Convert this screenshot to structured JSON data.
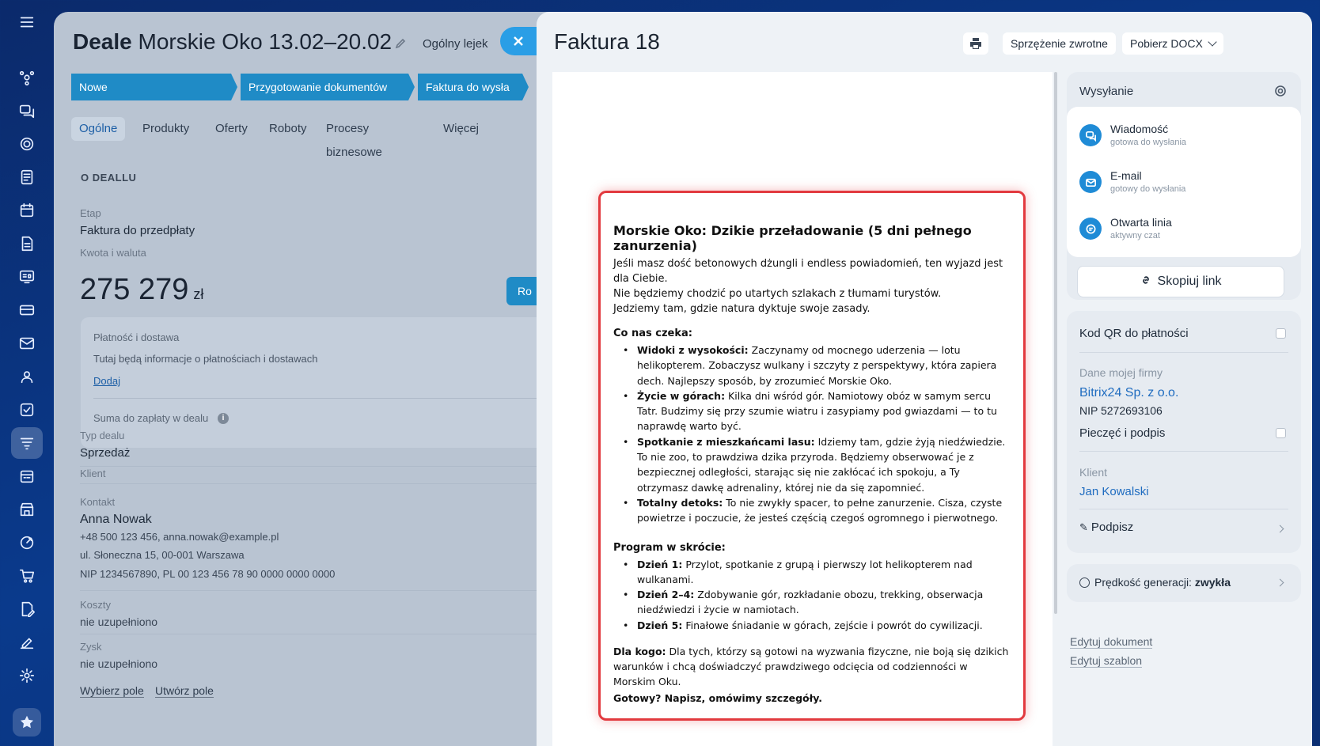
{
  "deal": {
    "title_bold": "Deale",
    "title_rest": " Morskie Oko 13.02–20.02",
    "funnel": "Ogólny lejek",
    "stages": [
      "Nowe",
      "Przygotowanie dokumentów",
      "Faktura do wysła"
    ],
    "tabs": [
      "Ogólne",
      "Produkty",
      "Oferty",
      "Roboty",
      "Procesy biznesowe",
      "Więcej"
    ],
    "section": "O DEALLU",
    "stage_label": "Etap",
    "stage_value": "Faktura do przedpłaty",
    "amount_label": "Kwota i waluta",
    "amount": "275 279",
    "currency": "zł",
    "ro_button": "Ro",
    "payment": {
      "title": "Płatność i dostawa",
      "text": "Tutaj będą informacje o płatnościach i dostawach",
      "add": "Dodaj",
      "sum": "Suma do zapłaty w dealu"
    },
    "type_label": "Typ dealu",
    "type_value": "Sprzedaż",
    "client_label": "Klient",
    "contact_label": "Kontakt",
    "contact_name": "Anna Nowak",
    "contact_phone": "+48 500 123 456, anna.nowak@example.pl",
    "contact_addr": "ul. Słoneczna 15, 00-001 Warszawa",
    "contact_nip": "NIP 1234567890, PL 00 123 456 78 90 0000 0000 0000",
    "costs_label": "Koszty",
    "costs_value": "nie uzupełniono",
    "profit_label": "Zysk",
    "profit_value": "nie uzupełniono",
    "choose_field": "Wybierz pole",
    "create_field": "Utwórz pole"
  },
  "panel": {
    "title": "Faktura 18",
    "feedback": "Sprzężenie zwrotne",
    "download": "Pobierz DOCX"
  },
  "document": {
    "heading": "Morskie Oko: Dzikie przeładowanie (5 dni pełnego zanurzenia)",
    "intro": [
      "Jeśli masz dość betonowych dżungli i endless powiadomień, ten wyjazd jest dla Ciebie.",
      "Nie będziemy chodzić po utartych szlakach z tłumami turystów.",
      "Jedziemy tam, gdzie natura dyktuje swoje zasady."
    ],
    "offer_title": "Co nas czeka:",
    "offer": [
      {
        "b": "Widoki z wysokości:",
        "t": " Zaczynamy od mocnego uderzenia — lotu helikopterem. Zobaczysz wulkany i szczyty z perspektywy, która zapiera dech. Najlepszy sposób, by zrozumieć Morskie Oko."
      },
      {
        "b": "Życie w górach:",
        "t": " Kilka dni wśród gór. Namiotowy obóz w samym sercu Tatr. Budzimy się przy szumie wiatru i zasypiamy pod gwiazdami — to tu naprawdę warto być."
      },
      {
        "b": "Spotkanie z mieszkańcami lasu:",
        "t": " Idziemy tam, gdzie żyją niedźwiedzie. To nie zoo, to prawdziwa dzika przyroda. Będziemy obserwować je z bezpiecznej odległości, starając się nie zakłócać ich spokoju, a Ty otrzymasz dawkę adrenaliny, której nie da się zapomnieć."
      },
      {
        "b": "Totalny detoks:",
        "t": " To nie zwykły spacer, to pełne zanurzenie. Cisza, czyste powietrze i poczucie, że jesteś częścią czegoś ogromnego i pierwotnego."
      }
    ],
    "program_title": "Program w skrócie:",
    "program": [
      {
        "b": "Dzień 1:",
        "t": " Przylot, spotkanie z grupą i pierwszy lot helikopterem nad wulkanami."
      },
      {
        "b": "Dzień 2–4:",
        "t": " Zdobywanie gór, rozkładanie obozu, trekking, obserwacja niedźwiedzi i życie w namiotach."
      },
      {
        "b": "Dzień 5:",
        "t": " Finałowe śniadanie w górach, zejście i powrót do cywilizacji."
      }
    ],
    "for_whom_b": "Dla kogo:",
    "for_whom_t": " Dla tych, którzy są gotowi na wyzwania fizyczne, nie boją się dzikich warunków i chcą doświadczyć prawdziwego odcięcia od codzienności w Morskim Oku.",
    "cta": "Gotowy? Napisz, omówimy szczegóły."
  },
  "sending": {
    "title": "Wysyłanie",
    "channels": [
      {
        "name": "Wiadomość",
        "status": "gotowa do wysłania"
      },
      {
        "name": "E-mail",
        "status": "gotowy do wysłania"
      },
      {
        "name": "Otwarta linia",
        "status": "aktywny czat"
      }
    ],
    "copy_link": "Skopiuj link"
  },
  "settings": {
    "qr": "Kod QR do płatności",
    "company_label": "Dane mojej firmy",
    "company_name": "Bitrix24 Sp. z o.o.",
    "company_nip": "NIP 5272693106",
    "stamp": "Pieczęć i podpis",
    "client_label": "Klient",
    "client_name": "Jan Kowalski",
    "sign": "Podpisz",
    "speed_label": "Prędkość generacji: ",
    "speed_value": "zwykła",
    "edit_doc": "Edytuj dokument",
    "edit_tpl": "Edytuj szablon"
  }
}
